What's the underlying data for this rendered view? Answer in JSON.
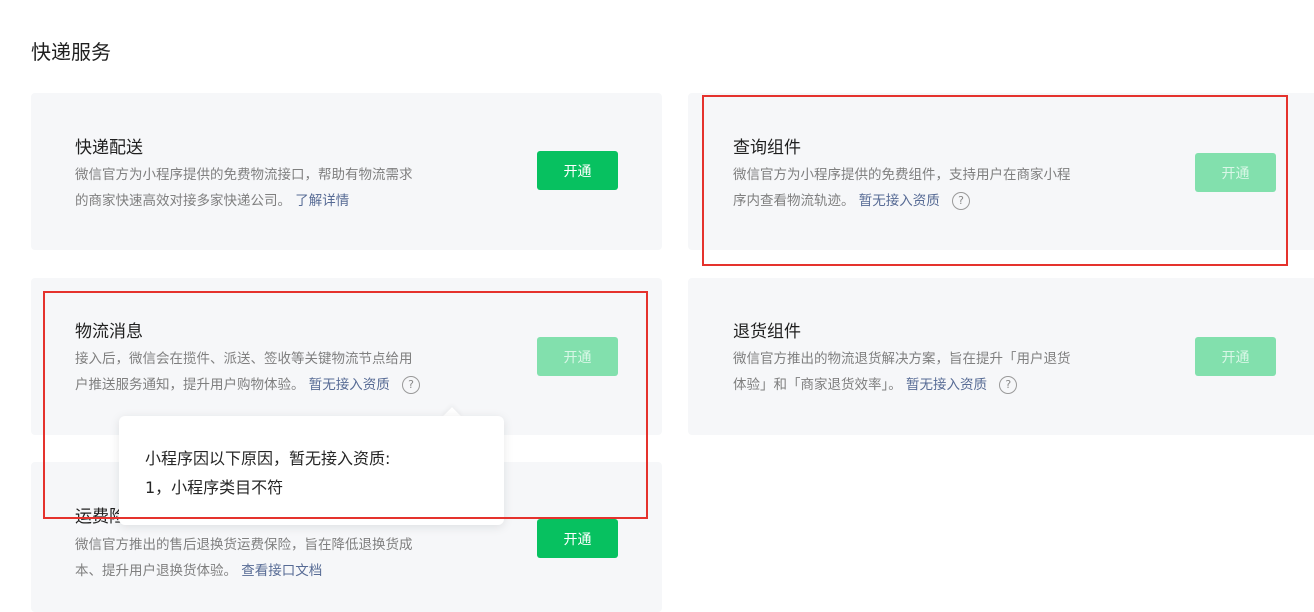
{
  "page": {
    "title": "快递服务"
  },
  "cards": {
    "express_delivery": {
      "title": "快递配送",
      "desc_line1": "微信官方为小程序提供的免费物流接口，帮助有物流需求",
      "desc_line2": "的商家快速高效对接多家快递公司。",
      "link": "了解详情",
      "button": "开通"
    },
    "query_component": {
      "title": "查询组件",
      "desc_line1": "微信官方为小程序提供的免费组件，支持用户在商家小程",
      "desc_line2": "序内查看物流轨迹。",
      "link": "暂无接入资质",
      "button": "开通"
    },
    "logistics_message": {
      "title": "物流消息",
      "desc_line1": "接入后，微信会在揽件、派送、签收等关键物流节点给用",
      "desc_line2": "户推送服务通知，提升用户购物体验。",
      "link": "暂无接入资质",
      "button": "开通"
    },
    "return_component": {
      "title": "退货组件",
      "desc_line1": "微信官方推出的物流退货解决方案，旨在提升「用户退货",
      "desc_line2": "体验」和「商家退货效率」。",
      "link": "暂无接入资质",
      "button": "开通"
    },
    "freight_insurance": {
      "title": "运费险",
      "desc_line1": "微信官方推出的售后退换货运费保险，旨在降低退换货成",
      "desc_line2": "本、提升用户退换货体验。",
      "link": "查看接口文档",
      "button": "开通"
    }
  },
  "help_icon_glyph": "?",
  "tooltip": {
    "line1": "小程序因以下原因，暂无接入资质:",
    "line2": "1，小程序类目不符"
  },
  "colors": {
    "primary_button": "#07c160",
    "disabled_button": "#82e0ad",
    "link": "#576b95",
    "highlight_border": "#e5322d",
    "card_bg": "#f6f7f9"
  }
}
